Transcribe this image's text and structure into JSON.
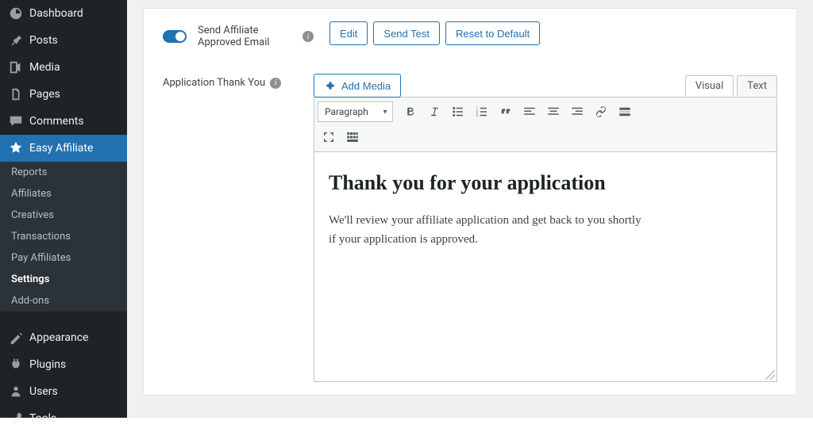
{
  "sidebar": {
    "dashboard": "Dashboard",
    "posts": "Posts",
    "media": "Media",
    "pages": "Pages",
    "comments": "Comments",
    "easy_affiliate": "Easy Affiliate",
    "sub": {
      "reports": "Reports",
      "affiliates": "Affiliates",
      "creatives": "Creatives",
      "transactions": "Transactions",
      "pay_affiliates": "Pay Affiliates",
      "settings": "Settings",
      "addons": "Add-ons"
    },
    "appearance": "Appearance",
    "plugins": "Plugins",
    "users": "Users",
    "tools": "Tools"
  },
  "settings": {
    "email_row": {
      "label": "Send Affiliate Approved Email",
      "edit": "Edit",
      "send_test": "Send Test",
      "reset": "Reset to Default"
    },
    "thankyou_row": {
      "label": "Application Thank You"
    }
  },
  "editor": {
    "add_media": "Add Media",
    "tab_visual": "Visual",
    "tab_text": "Text",
    "format_select": "Paragraph",
    "content": {
      "heading": "Thank you for your application",
      "body": "We'll review your affiliate application and get back to you shortly if your application is approved."
    }
  }
}
